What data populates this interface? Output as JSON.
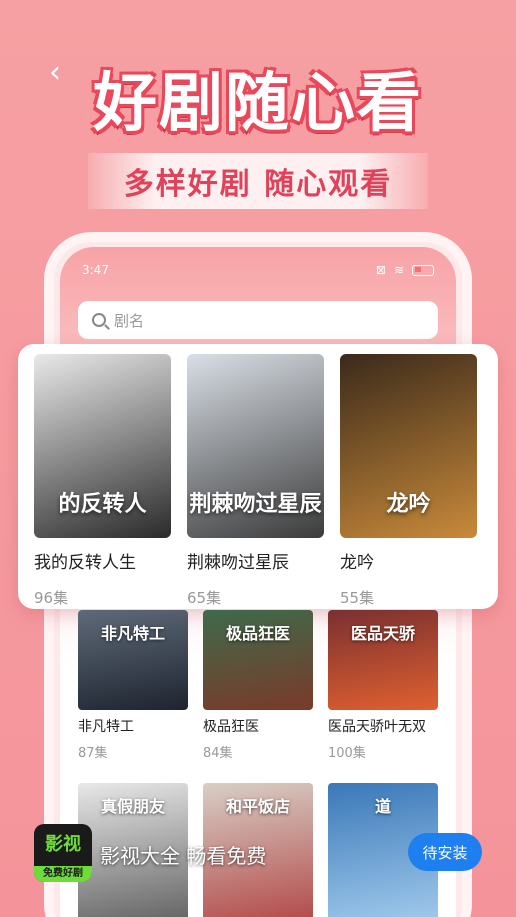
{
  "header": {
    "back_icon": "chevron-left-icon",
    "title": "好剧随心看",
    "subtitle": "多样好剧  随心观看"
  },
  "phone": {
    "status_time": "3:47",
    "search_placeholder": "剧名"
  },
  "featured": [
    {
      "name": "我的反转人生",
      "episodes": "96集",
      "poster_text": "的反转人",
      "colors": [
        "#e9e9e9",
        "#2a2a2a"
      ]
    },
    {
      "name": "荆棘吻过星辰",
      "episodes": "65集",
      "poster_text": "荆棘吻过星辰",
      "colors": [
        "#d9dfe6",
        "#3b3b3b"
      ]
    },
    {
      "name": "龙吟",
      "episodes": "55集",
      "poster_text": "龙吟",
      "colors": [
        "#3a2a1a",
        "#c98a3a"
      ]
    }
  ],
  "grid": [
    {
      "name": "非凡特工",
      "episodes": "87集",
      "poster_text": "非凡特工",
      "colors": [
        "#5f6a78",
        "#1e2430"
      ]
    },
    {
      "name": "极品狂医",
      "episodes": "84集",
      "poster_text": "极品狂医",
      "colors": [
        "#3e6a4a",
        "#7a3a2a"
      ]
    },
    {
      "name": "医品天骄叶无双",
      "episodes": "100集",
      "poster_text": "医品天骄",
      "colors": [
        "#7a3030",
        "#e06030"
      ]
    },
    {
      "name": "",
      "episodes": "",
      "poster_text": "真假朋友",
      "colors": [
        "#e8e8e8",
        "#5a5a5a"
      ]
    },
    {
      "name": "",
      "episodes": "",
      "poster_text": "和平饭店",
      "colors": [
        "#d8cfc6",
        "#b04040"
      ]
    },
    {
      "name": "",
      "episodes": "",
      "poster_text": "道",
      "colors": [
        "#3a78b8",
        "#a8d0f0"
      ]
    }
  ],
  "banner": {
    "logo_main": "影视",
    "logo_sub": "免费好剧",
    "text": "影视大全 畅看免费",
    "install_label": "待安装"
  }
}
